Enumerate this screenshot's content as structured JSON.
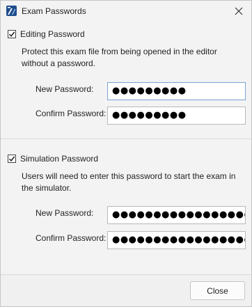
{
  "window": {
    "title": "Exam Passwords"
  },
  "editing": {
    "label": "Editing Password",
    "checked": true,
    "description": "Protect this exam file from being opened in the editor without a password.",
    "new_label": "New Password:",
    "new_value": "●●●●●●●●●",
    "confirm_label": "Confirm Password:",
    "confirm_value": "●●●●●●●●●"
  },
  "simulation": {
    "label": "Simulation Password",
    "checked": true,
    "description": "Users will need to enter this password to start the exam in the simulator.",
    "new_label": "New Password:",
    "new_value": "●●●●●●●●●●●●●●●●●●●●●",
    "confirm_label": "Confirm Password:",
    "confirm_value": "●●●●●●●●●●●●●●●●●●●●●"
  },
  "footer": {
    "close_label": "Close"
  },
  "icons": {
    "app": "app-logo-icon",
    "close": "close-icon",
    "check": "checkmark-icon"
  },
  "colors": {
    "window_bg": "#f3f3f3",
    "focus_border": "#7aa3d6",
    "app_icon_bg": "#1e4d8c"
  }
}
